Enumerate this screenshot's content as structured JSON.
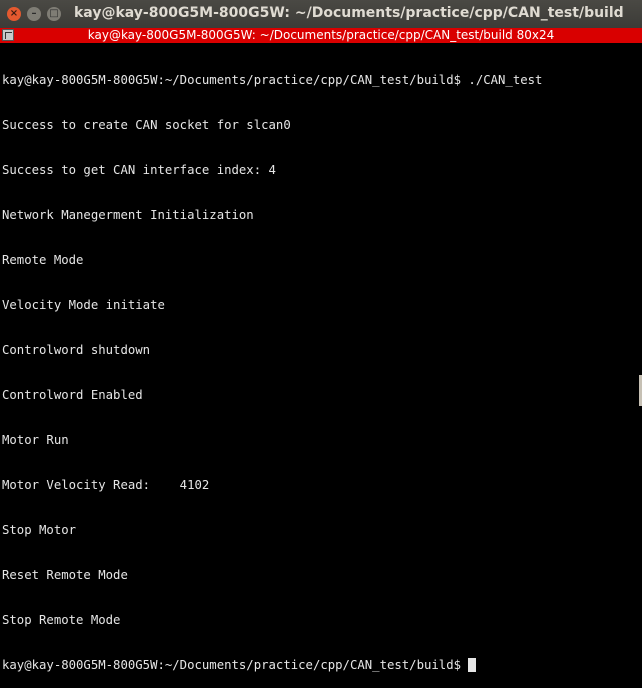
{
  "window": {
    "title": "kay@kay-800G5M-800G5W: ~/Documents/practice/cpp/CAN_test/build",
    "tab_title": "kay@kay-800G5M-800G5W: ~/Documents/practice/cpp/CAN_test/build 80x24",
    "close_glyph": "×",
    "minimize_glyph": "–",
    "maximize_glyph": "□"
  },
  "terminal": {
    "lines": [
      "kay@kay-800G5M-800G5W:~/Documents/practice/cpp/CAN_test/build$ ./CAN_test",
      "Success to create CAN socket for slcan0",
      "Success to get CAN interface index: 4",
      "Network Manegerment Initialization",
      "Remote Mode",
      "Velocity Mode initiate",
      "Controlword shutdown",
      "Controlword Enabled",
      "Motor Run",
      "Motor Velocity Read:    4102",
      "Stop Motor",
      "Reset Remote Mode",
      "Stop Remote Mode"
    ],
    "prompt": "kay@kay-800G5M-800G5W:~/Documents/practice/cpp/CAN_test/build$ "
  },
  "colors": {
    "background": "#000000",
    "text": "#e6e6e6",
    "tab_bar": "#d90000",
    "titlebar": "#3c3b37"
  }
}
